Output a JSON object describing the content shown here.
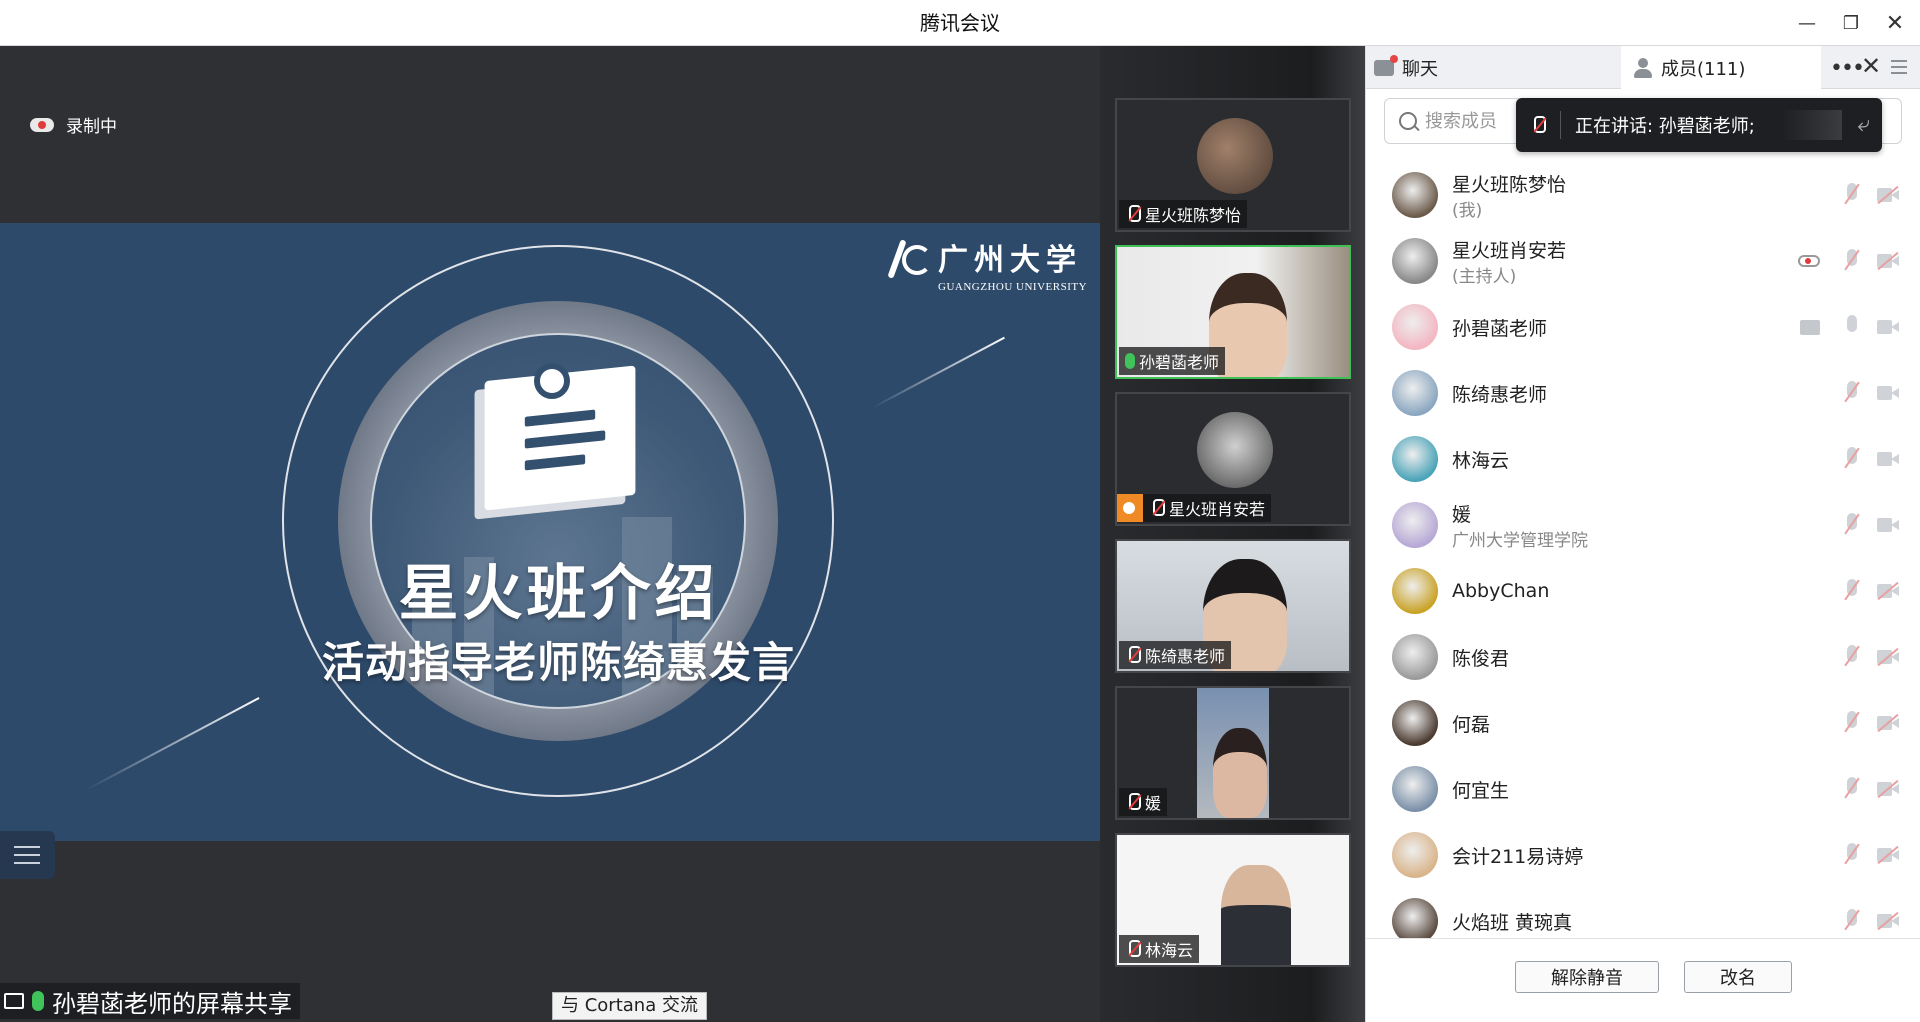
{
  "window": {
    "title": "腾讯会议",
    "minimize_icon": "minimize-icon",
    "maximize_icon": "restore-icon",
    "close_icon": "close-icon"
  },
  "stage": {
    "recording_label": "录制中",
    "slide": {
      "title": "星火班介绍",
      "subtitle": "活动指导老师陈绮惠发言",
      "logo_cn": "广州大学",
      "logo_en": "GUANGZHOU UNIVERSITY",
      "background_color": "#2e4a6b"
    },
    "share_label": "孙碧菡老师的屏幕共享",
    "cortana_label": "与 Cortana 交流"
  },
  "video_tiles": [
    {
      "name": "星火班陈梦怡",
      "mic": "off",
      "active": false
    },
    {
      "name": "孙碧菡老师",
      "mic": "on",
      "active": true
    },
    {
      "name": "星火班肖安若",
      "mic": "off",
      "active": false,
      "host": true
    },
    {
      "name": "陈绮惠老师",
      "mic": "off",
      "active": false
    },
    {
      "name": "媛",
      "mic": "off",
      "active": false
    },
    {
      "name": "林海云",
      "mic": "off",
      "active": false
    }
  ],
  "panel": {
    "tab_chat": "聊天",
    "tab_members": "成员(111)",
    "search_placeholder": "搜索成员",
    "speaking_text": "正在讲话: 孙碧菡老师;",
    "members": [
      {
        "name": "星火班陈梦怡",
        "sub": "(我)",
        "mic": "off",
        "cam": "off",
        "color": "#6b5a4a"
      },
      {
        "name": "星火班肖安若",
        "sub": "(主持人)",
        "mic": "off",
        "cam": "off",
        "recording": true,
        "color": "#888888"
      },
      {
        "name": "孙碧菡老师",
        "sub": "",
        "mic": "on",
        "cam": "on",
        "sharing": true,
        "color": "#f3b6c2"
      },
      {
        "name": "陈绮惠老师",
        "sub": "",
        "mic": "off",
        "cam": "on",
        "color": "#8aa6c0"
      },
      {
        "name": "林海云",
        "sub": "",
        "mic": "off",
        "cam": "on",
        "color": "#4aa3b8"
      },
      {
        "name": "媛",
        "sub": "广州大学管理学院",
        "mic": "off",
        "cam": "on",
        "color": "#b7a8d6"
      },
      {
        "name": "AbbyChan",
        "sub": "",
        "mic": "off",
        "cam": "off",
        "color": "#c9a227"
      },
      {
        "name": "陈俊君",
        "sub": "",
        "mic": "off",
        "cam": "off",
        "color": "#9a9a9a"
      },
      {
        "name": "何磊",
        "sub": "",
        "mic": "off",
        "cam": "off",
        "color": "#4a3a30"
      },
      {
        "name": "何宜生",
        "sub": "",
        "mic": "off",
        "cam": "off",
        "color": "#7a90a8"
      },
      {
        "name": "会计211易诗婷",
        "sub": "",
        "mic": "off",
        "cam": "off",
        "color": "#d9b48a"
      },
      {
        "name": "火焰班 黄琬真",
        "sub": "",
        "mic": "off",
        "cam": "off",
        "color": "#5a4a40"
      }
    ],
    "unmute_label": "解除静音",
    "rename_label": "改名"
  }
}
